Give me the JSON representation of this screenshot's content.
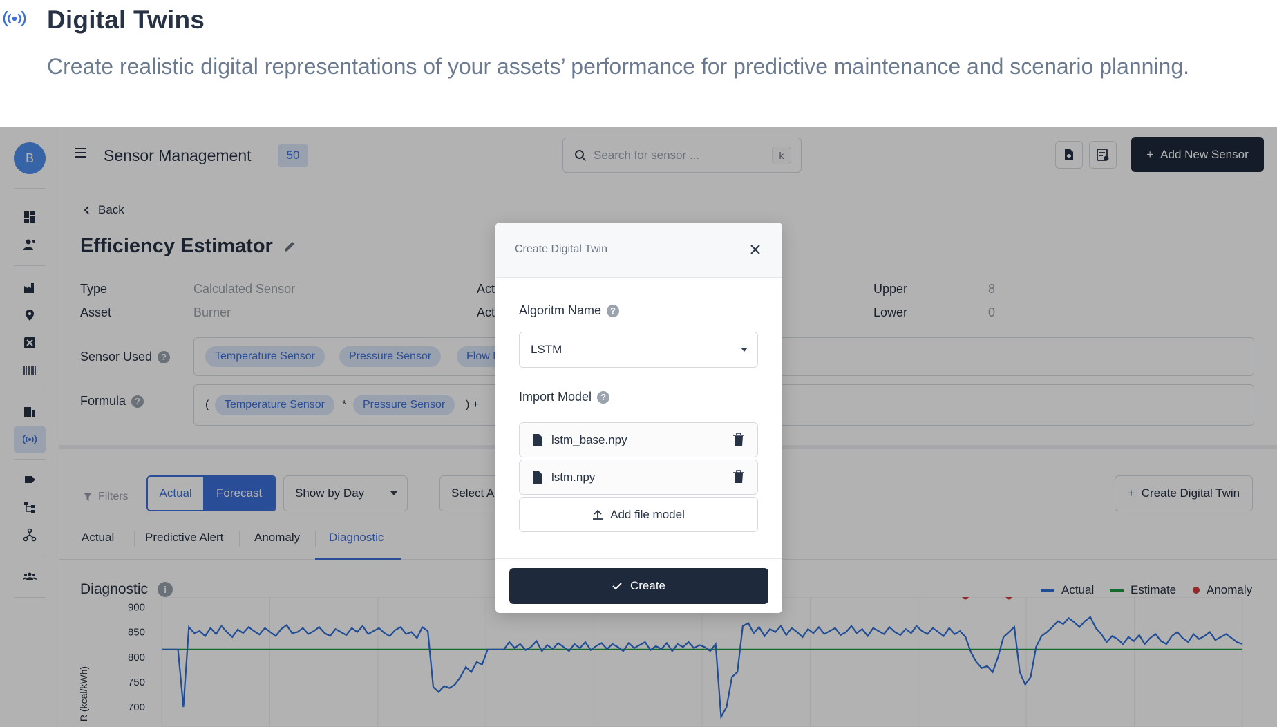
{
  "hero": {
    "title": "Digital Twins",
    "subtitle": "Create realistic digital representations of your assets’ performance for predictive maintenance and scenario planning."
  },
  "sidebar": {
    "avatar_initial": "B",
    "icons": [
      "dashboard-icon",
      "user-settings-icon",
      "factory-icon",
      "location-pin-icon",
      "close-box-icon",
      "barcode-icon",
      "sensor-device-icon",
      "broadcast-icon",
      "tag-icon",
      "hierarchy-icon",
      "network-icon",
      "team-icon"
    ],
    "active": "broadcast-icon"
  },
  "topbar": {
    "title": "Sensor Management",
    "count": "50",
    "search_placeholder": "Search for sensor ...",
    "search_shortcut": "k",
    "add_button": "Add New Sensor"
  },
  "detail": {
    "back_label": "Back",
    "title": "Efficiency Estimator",
    "type_label": "Type",
    "type_value": "Calculated Sensor",
    "asset_label": "Asset",
    "asset_value": "Burner",
    "act1_label": "Act",
    "act2_label": "Act",
    "upper_label": "Upper",
    "upper_value": "8",
    "lower_label": "Lower",
    "lower_value": "0",
    "sensor_used_label": "Sensor Used",
    "sensor_used": [
      "Temperature Sensor",
      "Pressure Sensor",
      "Flow M"
    ],
    "formula_label": "Formula",
    "formula": {
      "open": "(",
      "a": "Temperature Sensor",
      "op1": "*",
      "b": "Pressure Sensor",
      "close_plus": ") +"
    }
  },
  "filters": {
    "label": "Filters",
    "segment": [
      "Actual",
      "Forecast"
    ],
    "segment_selected": "Forecast",
    "show_by": "Show by Day",
    "select_partial": "Select A",
    "create_twin": "Create Digital Twin"
  },
  "tabs": {
    "items": [
      "Actual",
      "Predictive Alert",
      "Anomaly",
      "Diagnostic"
    ],
    "active": "Diagnostic"
  },
  "chart_section": {
    "title": "Diagnostic",
    "legend": [
      "Actual",
      "Estimate",
      "Anomaly"
    ]
  },
  "colors": {
    "actual": "#2f6fd6",
    "estimate": "#1f9a3e",
    "anomaly": "#d63a3a",
    "primary_dark": "#1e293b",
    "accent": "#3b6fd8"
  },
  "chart_data": {
    "type": "line",
    "ylabel": "R (kcal/kWh)",
    "yticks": [
      "900",
      "850",
      "800",
      "750",
      "700"
    ],
    "ylim": [
      660,
      920
    ],
    "x_count": 200,
    "series": [
      {
        "name": "Estimate",
        "values": [
          815,
          815,
          815,
          815,
          815,
          815,
          815,
          815,
          815,
          815,
          815,
          815,
          815,
          815,
          815,
          815,
          815,
          815,
          815,
          815,
          815,
          815,
          815,
          815,
          815,
          815,
          815,
          815,
          815,
          815,
          815,
          815,
          815,
          815,
          815,
          815,
          815,
          815,
          815,
          815,
          815,
          815,
          815,
          815,
          815,
          815,
          815,
          815,
          815,
          815,
          815,
          815,
          815,
          815,
          815,
          815,
          815,
          815,
          815,
          815,
          815,
          815,
          815,
          815,
          815,
          815,
          815,
          815,
          815,
          815,
          815,
          815,
          815,
          815,
          815,
          815,
          815,
          815,
          815,
          815,
          815,
          815,
          815,
          815,
          815,
          815,
          815,
          815,
          815,
          815,
          815,
          815,
          815,
          815,
          815,
          815,
          815,
          815,
          815,
          815,
          815,
          815,
          815,
          815,
          815,
          815,
          815,
          815,
          815,
          815,
          815,
          815,
          815,
          815,
          815,
          815,
          815,
          815,
          815,
          815,
          815,
          815,
          815,
          815,
          815,
          815,
          815,
          815,
          815,
          815,
          815,
          815,
          815,
          815,
          815,
          815,
          815,
          815,
          815,
          815,
          815,
          815,
          815,
          815,
          815,
          815,
          815,
          815,
          815,
          815,
          815,
          815,
          815,
          815,
          815,
          815,
          815,
          815,
          815,
          815,
          815,
          815,
          815,
          815,
          815,
          815,
          815,
          815,
          815,
          815,
          815,
          815,
          815,
          815,
          815,
          815,
          815,
          815,
          815,
          815,
          815,
          815,
          815,
          815,
          815,
          815,
          815,
          815,
          815,
          815,
          815,
          815,
          815,
          815,
          815,
          815,
          815,
          815,
          815,
          815
        ]
      },
      {
        "name": "Actual",
        "values": [
          815,
          815,
          815,
          815,
          700,
          860,
          848,
          852,
          842,
          858,
          846,
          862,
          850,
          840,
          855,
          848,
          860,
          852,
          845,
          858,
          850,
          842,
          856,
          864,
          848,
          850,
          858,
          846,
          852,
          860,
          848,
          842,
          856,
          850,
          844,
          858,
          850,
          862,
          846,
          852,
          858,
          848,
          842,
          854,
          860,
          846,
          850,
          838,
          860,
          852,
          740,
          730,
          742,
          738,
          745,
          760,
          780,
          770,
          790,
          785,
          815,
          815,
          815,
          815,
          830,
          818,
          826,
          814,
          820,
          832,
          812,
          824,
          816,
          828,
          820,
          812,
          826,
          818,
          830,
          814,
          822,
          828,
          816,
          826,
          820,
          812,
          828,
          818,
          824,
          830,
          814,
          822,
          816,
          828,
          812,
          826,
          820,
          830,
          818,
          824,
          820,
          812,
          826,
          680,
          700,
          760,
          770,
          862,
          868,
          848,
          860,
          842,
          856,
          850,
          862,
          844,
          858,
          850,
          840,
          856,
          848,
          860,
          846,
          852,
          858,
          844,
          850,
          862,
          848,
          856,
          842,
          858,
          852,
          846,
          860,
          850,
          844,
          856,
          848,
          862,
          852,
          846,
          858,
          850,
          842,
          858,
          846,
          852,
          840,
          810,
          790,
          778,
          782,
          770,
          800,
          840,
          850,
          860,
          770,
          745,
          760,
          820,
          842,
          850,
          860,
          872,
          866,
          878,
          870,
          860,
          872,
          880,
          858,
          846,
          830,
          842,
          836,
          826,
          840,
          832,
          844,
          826,
          838,
          846,
          832,
          826,
          842,
          850,
          838,
          830,
          846,
          836,
          842,
          850,
          834,
          840,
          846,
          838,
          830,
          826
        ]
      }
    ],
    "anomaly_points": [
      {
        "x": 101,
        "y": 922
      },
      {
        "x": 106,
        "y": 922
      },
      {
        "x": 148,
        "y": 922
      },
      {
        "x": 156,
        "y": 922
      }
    ]
  },
  "modal": {
    "title": "Create Digital Twin",
    "algorithm_label": "Algoritm Name",
    "algorithm_value": "LSTM",
    "import_label": "Import Model",
    "files": [
      "lstm_base.npy",
      "lstm.npy"
    ],
    "add_file": "Add file model",
    "create": "Create"
  }
}
